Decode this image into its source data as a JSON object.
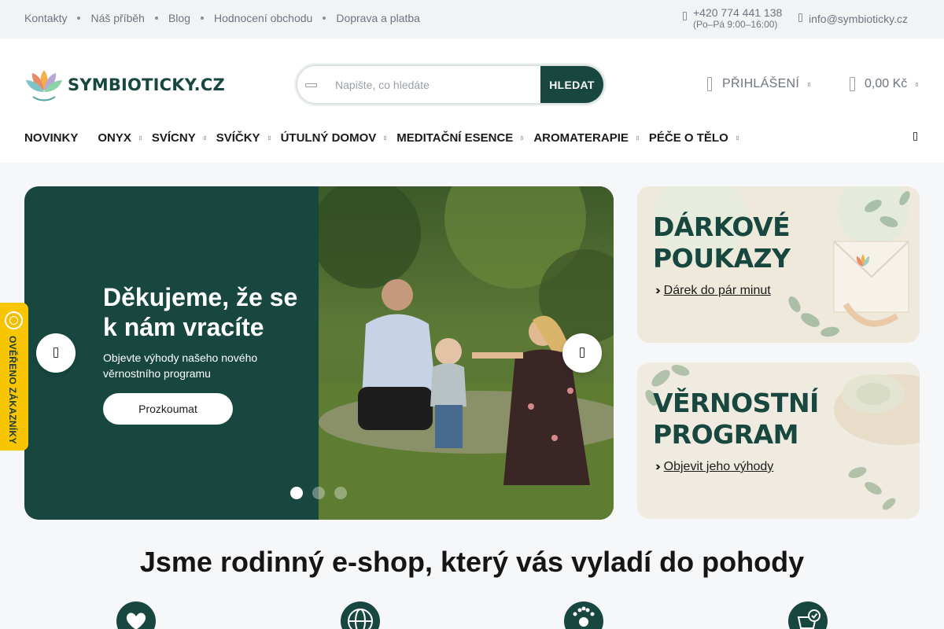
{
  "topbar": {
    "links": [
      "Kontakty",
      "Náš příběh",
      "Blog",
      "Hodnocení obchodu",
      "Doprava a platba"
    ],
    "phone": "+420 774 441 138",
    "hours": "(Po–Pá 9:00–16:00)",
    "email": "info@symbioticky.cz"
  },
  "header": {
    "logo_text": "SYMBIOTICKY.CZ",
    "search": {
      "placeholder": "Napište, co hledáte",
      "button": "HLEDAT"
    },
    "login_label": "PŘIHLÁŠENÍ",
    "cart_total": "0,00 Kč"
  },
  "nav": {
    "items": [
      {
        "label": "NOVINKY",
        "has_submenu": false
      },
      {
        "label": "ONYX",
        "has_submenu": true
      },
      {
        "label": "SVÍCNY",
        "has_submenu": true
      },
      {
        "label": "SVÍČKY",
        "has_submenu": true
      },
      {
        "label": "ÚTULNÝ DOMOV",
        "has_submenu": true
      },
      {
        "label": "MEDITAČNÍ ESENCE",
        "has_submenu": true
      },
      {
        "label": "AROMATERAPIE",
        "has_submenu": true
      },
      {
        "label": "PÉČE O TĚLO",
        "has_submenu": true
      }
    ]
  },
  "hero": {
    "title": "Děkujeme, že se k nám vracíte",
    "subtitle": "Objevte výhody našeho nového věrnostního programu",
    "cta": "Prozkoumat",
    "slides_count": 3,
    "active_slide": 1,
    "background": "#17473f"
  },
  "promos": [
    {
      "title_line1": "DÁRKOVÉ",
      "title_line2": "POUKAZY",
      "link": "Dárek do pár minut"
    },
    {
      "title_line1": "VĚRNOSTNÍ",
      "title_line2": "PROGRAM",
      "link": "Objevit jeho výhody"
    }
  ],
  "badge": {
    "text": "OVĚŘENO ZÁKAZNÍKY"
  },
  "section": {
    "title": "Jsme rodinný e-shop, který vás vyladí do pohody"
  },
  "colors": {
    "brand": "#17473f",
    "badge": "#f7c600",
    "top_bar": "#f2f3f5"
  },
  "feature_icons": [
    "heart-icon",
    "globe-icon",
    "rating-stars-icon",
    "basket-check-icon"
  ]
}
